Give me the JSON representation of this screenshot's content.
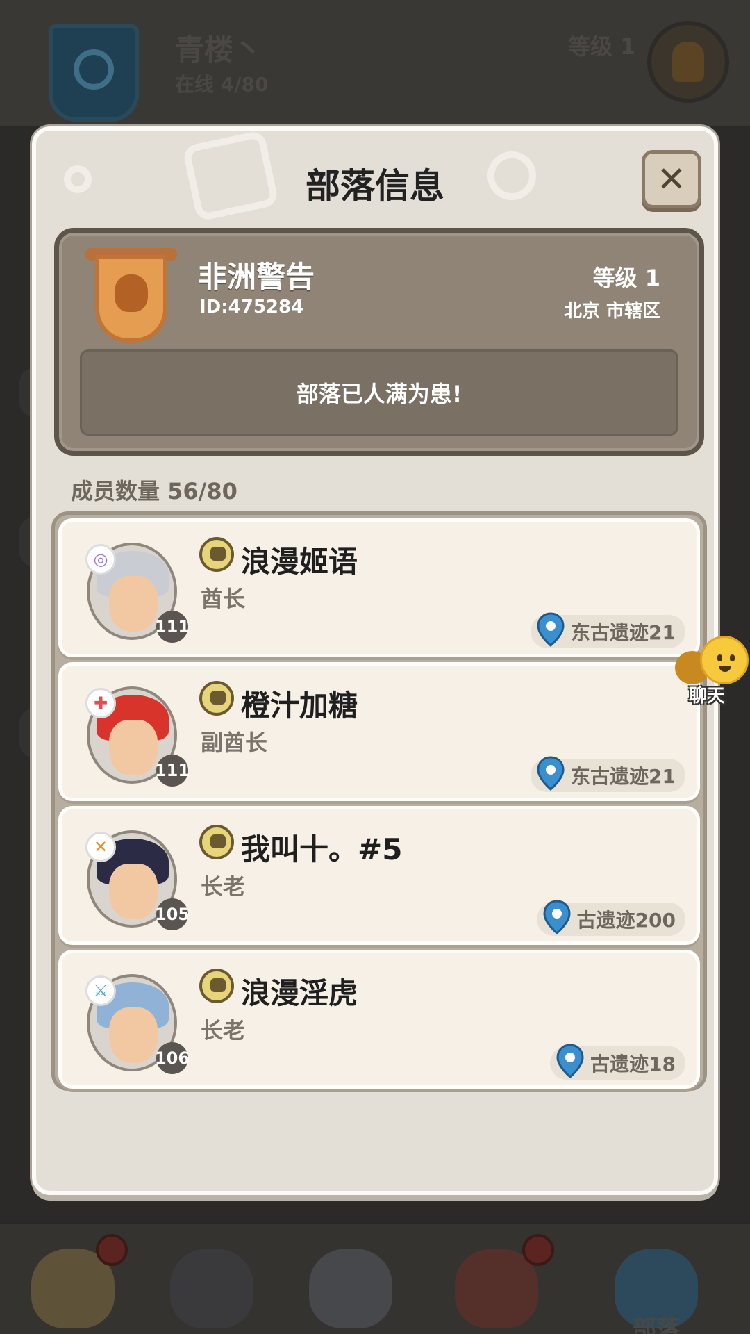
{
  "background": {
    "tribe_name": "青楼丶",
    "online": "在线 4/80",
    "level": "等级 1"
  },
  "modal": {
    "title": "部落信息",
    "close_label": "✕"
  },
  "tribe": {
    "name": "非洲警告",
    "id": "ID:475284",
    "level": "等级 1",
    "location": "北京 市辖区",
    "notice": "部落已人满为患!"
  },
  "member_count": "成员数量 56/80",
  "members": [
    {
      "name": "浪漫姬语",
      "role": "酋长",
      "level": "111",
      "location": "东古遗迹21",
      "hair_color": "#c9ccd3",
      "badge_color": "#a474d6",
      "badge_symbol": "◎"
    },
    {
      "name": "橙汁加糖",
      "role": "副酋长",
      "level": "111",
      "location": "东古遗迹21",
      "hair_color": "#d8342c",
      "badge_color": "#e05050",
      "badge_symbol": "✚"
    },
    {
      "name": "我叫十。#5",
      "role": "长老",
      "level": "105",
      "location": "古遗迹200",
      "hair_color": "#2b2b46",
      "badge_color": "#f08a2a",
      "badge_symbol": "✕"
    },
    {
      "name": "浪漫淫虎",
      "role": "长老",
      "level": "106",
      "location": "古遗迹18",
      "hair_color": "#8fb2d6",
      "badge_color": "#4aa0e0",
      "badge_symbol": "⚔"
    }
  ],
  "chat": {
    "label": "聊天"
  },
  "bottom_nav": {
    "tribe_label": "部落"
  },
  "colors": {
    "accent_pin": "#3a8fd0",
    "modal_bg": "#e3ded6",
    "tribe_card_bg": "#8f8475"
  }
}
